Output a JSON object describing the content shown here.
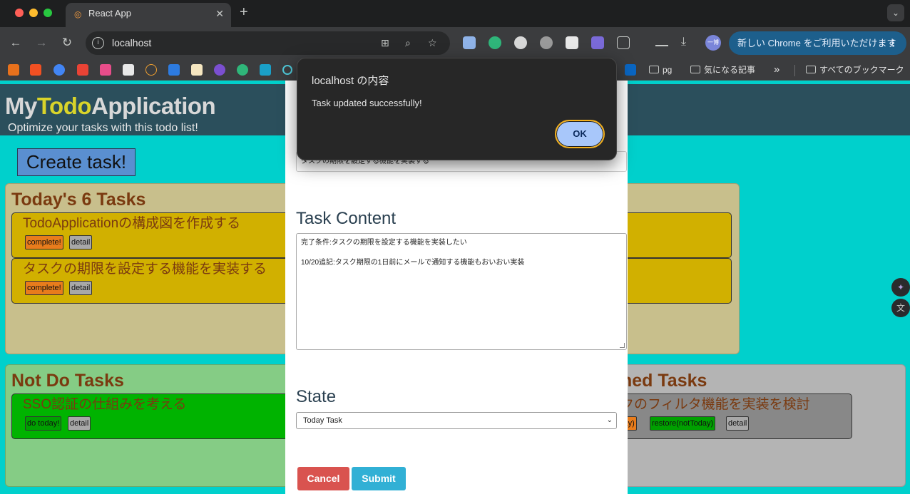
{
  "browser": {
    "tab_title": "React App",
    "tab_close": "✕",
    "new_tab": "+",
    "tab_menu": "⌄",
    "back": "←",
    "forward": "→",
    "reload": "↻",
    "url": "localhost",
    "update_label": "新しい Chrome をご利用いただけます",
    "update_more": "⋮",
    "profile_initial": "一博",
    "bookmarks": {
      "folder_1": "pg",
      "folder_2": "気になる記事",
      "overflow": "»",
      "all_bookmarks": "すべてのブックマーク"
    }
  },
  "app": {
    "title_part1": "My",
    "title_part2": "Todo",
    "title_part3": "Application",
    "subtitle": "Optimize your tasks with this todo list!",
    "create_button": "Create task!"
  },
  "today_panel": {
    "title": "Today's 6 Tasks",
    "color": "#c8bf8c",
    "tasks": [
      {
        "title": "TodoApplicationの構成図を作成する",
        "complete": "complete!",
        "detail": "detail"
      },
      {
        "title": "タスクの期限を設定する機能を実装する",
        "complete": "complete!",
        "detail": "detail"
      }
    ]
  },
  "not_do_panel": {
    "title": "Not Do Tasks",
    "color": "#85cc85",
    "tasks": [
      {
        "title": "SSO認証の仕組みを考える",
        "do_today": "do today!",
        "detail": "detail"
      }
    ]
  },
  "finished_panel": {
    "title_visible": "hed Tasks",
    "color": "#b4b4b4",
    "tasks": [
      {
        "title_visible": "クのフィルタ機能を実装を検討",
        "restore_today": "e(Today)",
        "restore_not_today": "restore(notToday)",
        "detail": "detail"
      }
    ]
  },
  "modal": {
    "title_value": "タスクの期限を設定する機能を実装する",
    "content_label": "Task Content",
    "content_lines": [
      "完了条件:タスクの期限を設定する機能を実装したい",
      "10/20追記:タスク期限の1日前にメールで通知する機能もおいおい実装"
    ],
    "state_label": "State",
    "state_value": "Today Task",
    "cancel": "Cancel",
    "submit": "Submit"
  },
  "alert": {
    "title": "localhost の内容",
    "message": "Task updated successfully!",
    "ok": "OK"
  },
  "colors": {
    "page_bg": "#00d0cc",
    "header_bg": "#2b4f5c",
    "today_card": "#d1b000",
    "not_do_card": "#00b300",
    "finished_card": "#888888",
    "complete_button": "#e87c1c",
    "detail_button": "#a8a8a8"
  }
}
